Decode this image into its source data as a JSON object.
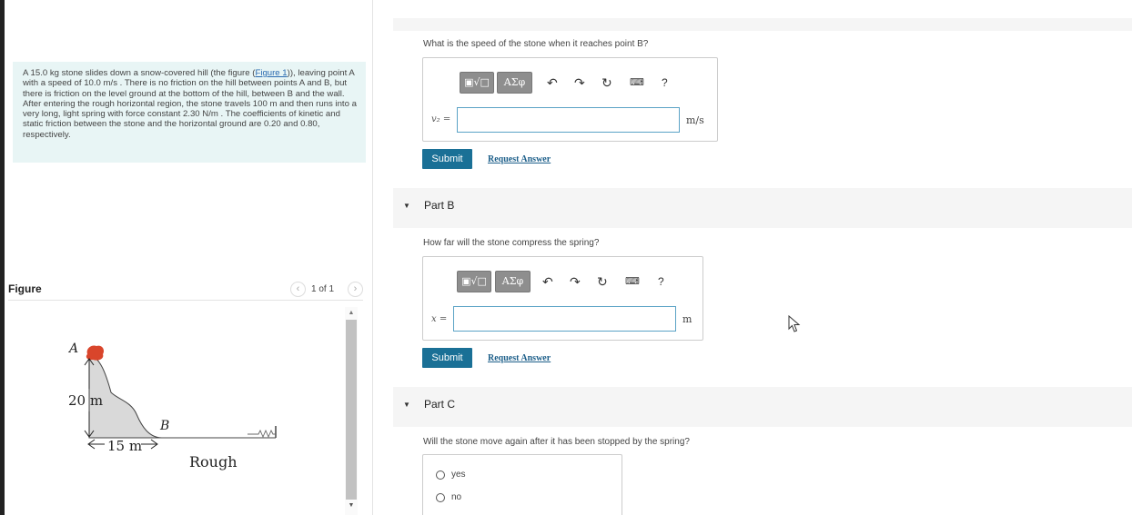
{
  "problem": {
    "text_before_link": "A 15.0 kg stone slides down a snow-covered hill (the figure (",
    "link": "Figure 1",
    "text_after_link": ")), leaving point A with a speed of 10.0 m/s . There is no friction on the hill between points A and B, but there is friction on the level ground at the bottom of the hill, between B and the wall. After entering the rough horizontal region, the stone travels 100 m and then runs into a very long, light spring with force constant 2.30 N/m . The coefficients of kinetic and static friction between the stone and the horizontal ground are 0.20 and 0.80, respectively."
  },
  "figure": {
    "title": "Figure",
    "page": "1 of 1",
    "prev_icon": "chevron-left-icon",
    "next_icon": "chevron-right-icon",
    "labels": {
      "point_a": "A",
      "point_b": "B",
      "height": "20 m",
      "distance": "15 m",
      "region": "Rough"
    },
    "stone_color": "#d9452b",
    "hill_fill": "#d9d9d9"
  },
  "toolbar": {
    "template_icon": "▣√□",
    "greek_label": "ΑΣφ",
    "undo_icon": "undo-icon",
    "redo_icon": "redo-icon",
    "reset_icon": "reset-icon",
    "keyboard_icon": "keyboard-icon",
    "help_label": "?"
  },
  "part_a": {
    "question": "What is the speed of the stone when it reaches point B?",
    "variable": "v₂ =",
    "value": "",
    "unit": "m/s",
    "submit": "Submit",
    "request": "Request Answer"
  },
  "part_b": {
    "title": "Part B",
    "question": "How far will the stone compress the spring?",
    "variable": "x =",
    "value": "",
    "unit": "m",
    "submit": "Submit",
    "request": "Request Answer"
  },
  "part_c": {
    "title": "Part C",
    "question": "Will the stone move again after it has been stopped by the spring?",
    "options": [
      "yes",
      "no"
    ]
  },
  "colors": {
    "accent": "#1a7096",
    "problem_bg": "#e8f5f5",
    "input_border": "#5ba3c6"
  }
}
